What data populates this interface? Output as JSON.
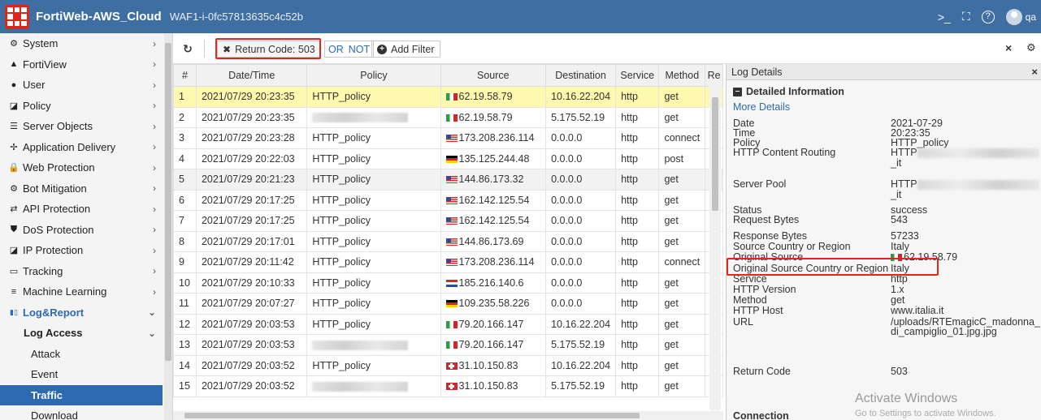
{
  "header": {
    "brand": "FortiWeb-AWS_Cloud",
    "device": "WAF1-i-0fc57813635c4c52b",
    "cli_icon": ">_",
    "fullscreen_icon": "⛶",
    "help_icon": "?",
    "user": "qa"
  },
  "sidebar": {
    "items": [
      {
        "label": "System",
        "icon": "⚙"
      },
      {
        "label": "FortiView",
        "icon": "▲"
      },
      {
        "label": "User",
        "icon": "●"
      },
      {
        "label": "Policy",
        "icon": "◪"
      },
      {
        "label": "Server Objects",
        "icon": "☰"
      },
      {
        "label": "Application Delivery",
        "icon": "✢"
      },
      {
        "label": "Web Protection",
        "icon": "🔒"
      },
      {
        "label": "Bot Mitigation",
        "icon": "⚙"
      },
      {
        "label": "API Protection",
        "icon": "⇄"
      },
      {
        "label": "DoS Protection",
        "icon": "⛊"
      },
      {
        "label": "IP Protection",
        "icon": "◪"
      },
      {
        "label": "Tracking",
        "icon": "▭"
      },
      {
        "label": "Machine Learning",
        "icon": "≡"
      }
    ],
    "section": {
      "label": "Log&Report",
      "icon": "ılıl"
    },
    "sub": {
      "label": "Log Access"
    },
    "children": [
      "Attack",
      "Event",
      "Traffic",
      "Download"
    ]
  },
  "filter": {
    "chip": "Return Code: 503",
    "or": "OR",
    "not": "NOT",
    "add": "Add Filter",
    "refresh_icon": "↻",
    "clear_icon": "×",
    "settings_icon": "⚙"
  },
  "table": {
    "columns": [
      "#",
      "Date/Time",
      "Policy",
      "Source",
      "Destination",
      "Service",
      "Method",
      "Re"
    ],
    "rows": [
      {
        "n": "1",
        "dt": "2021/07/29 20:23:35",
        "policy": "HTTP_policy",
        "flag": "it",
        "src": "62.19.58.79",
        "dst": "10.16.22.204",
        "svc": "http",
        "method": "get"
      },
      {
        "n": "2",
        "dt": "2021/07/29 20:23:35",
        "policy": "",
        "flag": "it",
        "src": "62.19.58.79",
        "dst": "5.175.52.19",
        "svc": "http",
        "method": "get"
      },
      {
        "n": "3",
        "dt": "2021/07/29 20:23:28",
        "policy": "HTTP_policy",
        "flag": "us",
        "src": "173.208.236.114",
        "dst": "0.0.0.0",
        "svc": "http",
        "method": "connect"
      },
      {
        "n": "4",
        "dt": "2021/07/29 20:22:03",
        "policy": "HTTP_policy",
        "flag": "de",
        "src": "135.125.244.48",
        "dst": "0.0.0.0",
        "svc": "http",
        "method": "post"
      },
      {
        "n": "5",
        "dt": "2021/07/29 20:21:23",
        "policy": "HTTP_policy",
        "flag": "us",
        "src": "144.86.173.32",
        "dst": "0.0.0.0",
        "svc": "http",
        "method": "get"
      },
      {
        "n": "6",
        "dt": "2021/07/29 20:17:25",
        "policy": "HTTP_policy",
        "flag": "us",
        "src": "162.142.125.54",
        "dst": "0.0.0.0",
        "svc": "http",
        "method": "get"
      },
      {
        "n": "7",
        "dt": "2021/07/29 20:17:25",
        "policy": "HTTP_policy",
        "flag": "us",
        "src": "162.142.125.54",
        "dst": "0.0.0.0",
        "svc": "http",
        "method": "get"
      },
      {
        "n": "8",
        "dt": "2021/07/29 20:17:01",
        "policy": "HTTP_policy",
        "flag": "us",
        "src": "144.86.173.69",
        "dst": "0.0.0.0",
        "svc": "http",
        "method": "get"
      },
      {
        "n": "9",
        "dt": "2021/07/29 20:11:42",
        "policy": "HTTP_policy",
        "flag": "us",
        "src": "173.208.236.114",
        "dst": "0.0.0.0",
        "svc": "http",
        "method": "connect"
      },
      {
        "n": "10",
        "dt": "2021/07/29 20:10:33",
        "policy": "HTTP_policy",
        "flag": "nl",
        "src": "185.216.140.6",
        "dst": "0.0.0.0",
        "svc": "http",
        "method": "get"
      },
      {
        "n": "11",
        "dt": "2021/07/29 20:07:27",
        "policy": "HTTP_policy",
        "flag": "de",
        "src": "109.235.58.226",
        "dst": "0.0.0.0",
        "svc": "http",
        "method": "get"
      },
      {
        "n": "12",
        "dt": "2021/07/29 20:03:53",
        "policy": "HTTP_policy",
        "flag": "it",
        "src": "79.20.166.147",
        "dst": "10.16.22.204",
        "svc": "http",
        "method": "get"
      },
      {
        "n": "13",
        "dt": "2021/07/29 20:03:53",
        "policy": "",
        "flag": "it",
        "src": "79.20.166.147",
        "dst": "5.175.52.19",
        "svc": "http",
        "method": "get"
      },
      {
        "n": "14",
        "dt": "2021/07/29 20:03:52",
        "policy": "HTTP_policy",
        "flag": "ch",
        "src": "31.10.150.83",
        "dst": "10.16.22.204",
        "svc": "http",
        "method": "get"
      },
      {
        "n": "15",
        "dt": "2021/07/29 20:03:52",
        "policy": "",
        "flag": "ch",
        "src": "31.10.150.83",
        "dst": "5.175.52.19",
        "svc": "http",
        "method": "get"
      }
    ]
  },
  "details": {
    "title": "Log Details",
    "close_icon": "×",
    "section": "Detailed Information",
    "more": "More Details",
    "fields": [
      {
        "k": "Date",
        "v": "2021-07-29"
      },
      {
        "k": "Time",
        "v": "20:23:35"
      },
      {
        "k": "Policy",
        "v": "HTTP_policy"
      },
      {
        "k": "HTTP Content Routing",
        "v": "HTTP",
        "v2": "_it"
      },
      {
        "k": "Server Pool",
        "v": "HTTP",
        "v2": "_it"
      },
      {
        "k": "Status",
        "v": "success"
      },
      {
        "k": "Request Bytes",
        "v": "543"
      },
      {
        "k": "Response Bytes",
        "v": "57233"
      },
      {
        "k": "Source Country or Region",
        "v": "Italy"
      },
      {
        "k": "Original Source",
        "v": "62.19.58.79"
      },
      {
        "k": "Original Source Country or Region",
        "v": "Italy"
      },
      {
        "k": "Service",
        "v": "http"
      },
      {
        "k": "HTTP Version",
        "v": "1.x"
      },
      {
        "k": "Method",
        "v": "get"
      },
      {
        "k": "HTTP Host",
        "v": "www.italia.it"
      },
      {
        "k": "URL",
        "v": "/uploads/RTEmagicC_madonna_",
        "v2": "di_campiglio_01.jpg.jpg"
      },
      {
        "k": "Return Code",
        "v": "503"
      }
    ],
    "connection": "Connection"
  },
  "watermark": {
    "line1": "Activate Windows",
    "line2": "Go to Settings to activate Windows."
  }
}
